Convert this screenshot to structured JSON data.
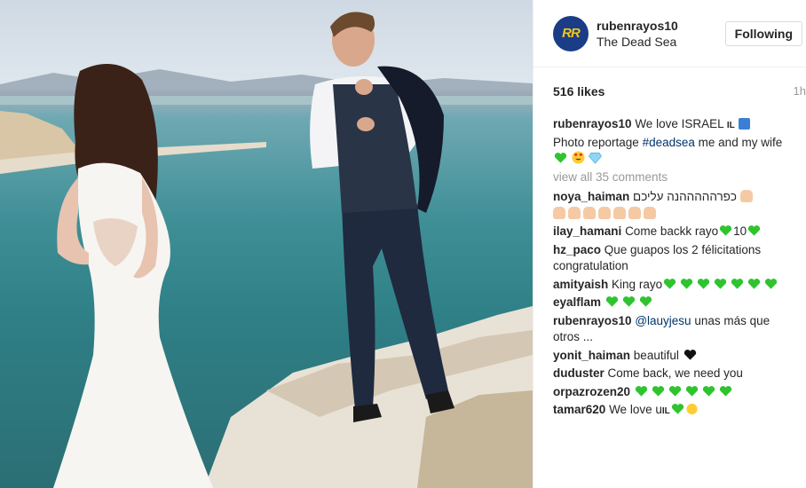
{
  "header": {
    "username": "rubenrayos10",
    "location": "The Dead Sea",
    "follow_label": "Following",
    "avatar_text": "RR"
  },
  "stats": {
    "likes": "516 likes",
    "time": "1h"
  },
  "caption": {
    "user": "rubenrayos10",
    "text_1": "We love ISRAEL",
    "flag": "IL",
    "text_2": "Photo reportage",
    "hashtag": "#deadsea",
    "text_3": "me and my wife"
  },
  "view_all": "view all 35 comments",
  "comments": [
    {
      "user": "noya_haiman",
      "text": "כפרהההההנה עליכם",
      "hearts": 0
    },
    {
      "user": "ilay_hamani",
      "text": "Come backk rayo",
      "hearts": 0,
      "mid": "10"
    },
    {
      "user": "hz_paco",
      "text": "Que guapos los 2 félicitations congratulation",
      "hearts": 0
    },
    {
      "user": "amityaish",
      "text": "King rayo",
      "hearts": 7
    },
    {
      "user": "eyalflam",
      "text": "",
      "hearts": 3
    },
    {
      "user": "rubenrayos10",
      "mention": "@lauyjesu",
      "text": "unas más que otros ...",
      "hearts": 0
    },
    {
      "user": "yonit_haiman",
      "text": "beautiful",
      "hearts": 0
    },
    {
      "user": "duduster",
      "text": "Come back, we need you",
      "hearts": 0
    },
    {
      "user": "orpazrozen20",
      "text": "",
      "hearts": 6
    },
    {
      "user": "tamar620",
      "text": "We love u",
      "flag": "IL",
      "hearts": 1
    }
  ],
  "colors": {
    "green_heart": "#2fc42f",
    "link": "#003569",
    "muted": "#999999"
  }
}
